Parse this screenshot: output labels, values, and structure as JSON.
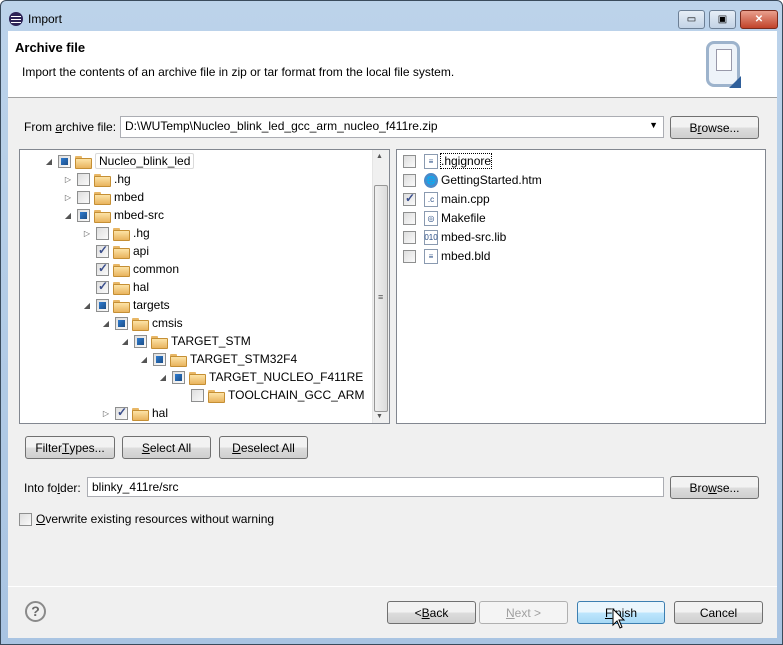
{
  "window": {
    "title": "Import"
  },
  "header": {
    "title": "Archive file",
    "description": "Import the contents of an archive file in zip or tar format from the local file system."
  },
  "source": {
    "label_pre": "From ",
    "label_u": "a",
    "label_post": "rchive file:",
    "value": "D:\\WUTemp\\Nucleo_blink_led_gcc_arm_nucleo_f411re.zip",
    "browse_pre": "B",
    "browse_u": "r",
    "browse_post": "owse..."
  },
  "tree": [
    {
      "label": "Nucleo_blink_led",
      "level": 0,
      "expander": "expanded",
      "check": "partial"
    },
    {
      "label": ".hg",
      "level": 1,
      "expander": "collapsed",
      "check": "unchecked"
    },
    {
      "label": "mbed",
      "level": 1,
      "expander": "collapsed",
      "check": "unchecked"
    },
    {
      "label": "mbed-src",
      "level": 1,
      "expander": "expanded",
      "check": "partial"
    },
    {
      "label": ".hg",
      "level": 2,
      "expander": "collapsed",
      "check": "unchecked"
    },
    {
      "label": "api",
      "level": 2,
      "expander": "none",
      "check": "checked"
    },
    {
      "label": "common",
      "level": 2,
      "expander": "none",
      "check": "checked"
    },
    {
      "label": "hal",
      "level": 2,
      "expander": "none",
      "check": "checked"
    },
    {
      "label": "targets",
      "level": 2,
      "expander": "expanded",
      "check": "partial"
    },
    {
      "label": "cmsis",
      "level": 3,
      "expander": "expanded",
      "check": "partial"
    },
    {
      "label": "TARGET_STM",
      "level": 4,
      "expander": "expanded",
      "check": "partial"
    },
    {
      "label": "TARGET_STM32F4",
      "level": 5,
      "expander": "expanded",
      "check": "partial"
    },
    {
      "label": "TARGET_NUCLEO_F411RE",
      "level": 6,
      "expander": "expanded",
      "check": "partial"
    },
    {
      "label": "TOOLCHAIN_GCC_ARM",
      "level": 7,
      "expander": "none",
      "check": "unchecked"
    },
    {
      "label": "hal",
      "level": 3,
      "expander": "collapsed",
      "check": "checked"
    }
  ],
  "files": [
    {
      "label": ".hgignore",
      "icon": "text-file-icon",
      "icon_glyph": "≡",
      "checked": false
    },
    {
      "label": "GettingStarted.htm",
      "icon": "globe-icon",
      "icon_glyph": "🌐",
      "checked": false
    },
    {
      "label": "main.cpp",
      "icon": "cpp-file-icon",
      "icon_glyph": ".c",
      "checked": true
    },
    {
      "label": "Makefile",
      "icon": "makefile-icon",
      "icon_glyph": "◎",
      "checked": false
    },
    {
      "label": "mbed-src.lib",
      "icon": "binary-file-icon",
      "icon_glyph": "010",
      "checked": false
    },
    {
      "label": "mbed.bld",
      "icon": "text-file-icon",
      "icon_glyph": "≡",
      "checked": false
    }
  ],
  "buttons": {
    "filter_pre": "Filter ",
    "filter_u": "T",
    "filter_post": "ypes...",
    "select_u": "S",
    "select_post": "elect All",
    "deselect_u": "D",
    "deselect_post": "eselect All"
  },
  "dest": {
    "label_pre": "Into fo",
    "label_u": "l",
    "label_post": "der:",
    "value": "blinky_411re/src",
    "browse_pre": "Bro",
    "browse_u": "w",
    "browse_post": "se..."
  },
  "overwrite": {
    "label_u": "O",
    "label_post": "verwrite existing resources without warning",
    "checked": false
  },
  "footer": {
    "back_pre": "< ",
    "back_u": "B",
    "back_post": "ack",
    "next_u": "N",
    "next_post": "ext >",
    "finish_u": "F",
    "finish_post": "inish",
    "cancel": "Cancel",
    "help": "?"
  }
}
